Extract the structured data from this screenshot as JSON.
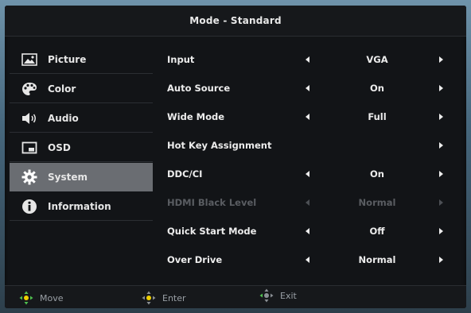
{
  "title": "Mode - Standard",
  "sidebar": {
    "items": [
      {
        "label": "Picture",
        "icon": "picture-icon"
      },
      {
        "label": "Color",
        "icon": "palette-icon"
      },
      {
        "label": "Audio",
        "icon": "speaker-icon"
      },
      {
        "label": "OSD",
        "icon": "osd-icon"
      },
      {
        "label": "System",
        "icon": "gear-icon",
        "active": true
      },
      {
        "label": "Information",
        "icon": "info-icon"
      }
    ]
  },
  "settings": [
    {
      "label": "Input",
      "value": "VGA",
      "has_left": true,
      "has_right": true,
      "enabled": true
    },
    {
      "label": "Auto Source",
      "value": "On",
      "has_left": true,
      "has_right": true,
      "enabled": true
    },
    {
      "label": "Wide Mode",
      "value": "Full",
      "has_left": true,
      "has_right": true,
      "enabled": true
    },
    {
      "label": "Hot Key Assignment",
      "value": "",
      "has_left": false,
      "has_right": true,
      "enabled": true
    },
    {
      "label": "DDC/CI",
      "value": "On",
      "has_left": true,
      "has_right": true,
      "enabled": true
    },
    {
      "label": "HDMI Black Level",
      "value": "Normal",
      "has_left": true,
      "has_right": true,
      "enabled": false
    },
    {
      "label": "Quick Start Mode",
      "value": "Off",
      "has_left": true,
      "has_right": true,
      "enabled": true
    },
    {
      "label": "Over Drive",
      "value": "Normal",
      "has_left": true,
      "has_right": true,
      "enabled": true
    }
  ],
  "footer": {
    "move": "Move",
    "enter": "Enter",
    "exit": "Exit"
  },
  "colors": {
    "accent": "#f0d000",
    "active_bg": "#6a6d72",
    "panel_bg": "#121417"
  }
}
